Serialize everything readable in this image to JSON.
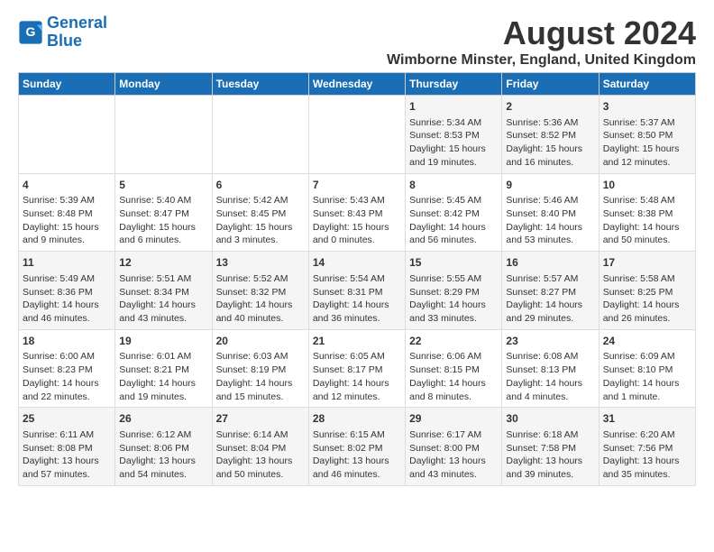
{
  "header": {
    "logo_general": "General",
    "logo_blue": "Blue",
    "title": "August 2024",
    "subtitle": "Wimborne Minster, England, United Kingdom"
  },
  "days_of_week": [
    "Sunday",
    "Monday",
    "Tuesday",
    "Wednesday",
    "Thursday",
    "Friday",
    "Saturday"
  ],
  "weeks": [
    {
      "days": [
        {
          "num": "",
          "content": ""
        },
        {
          "num": "",
          "content": ""
        },
        {
          "num": "",
          "content": ""
        },
        {
          "num": "",
          "content": ""
        },
        {
          "num": "1",
          "content": "Sunrise: 5:34 AM\nSunset: 8:53 PM\nDaylight: 15 hours\nand 19 minutes."
        },
        {
          "num": "2",
          "content": "Sunrise: 5:36 AM\nSunset: 8:52 PM\nDaylight: 15 hours\nand 16 minutes."
        },
        {
          "num": "3",
          "content": "Sunrise: 5:37 AM\nSunset: 8:50 PM\nDaylight: 15 hours\nand 12 minutes."
        }
      ]
    },
    {
      "days": [
        {
          "num": "4",
          "content": "Sunrise: 5:39 AM\nSunset: 8:48 PM\nDaylight: 15 hours\nand 9 minutes."
        },
        {
          "num": "5",
          "content": "Sunrise: 5:40 AM\nSunset: 8:47 PM\nDaylight: 15 hours\nand 6 minutes."
        },
        {
          "num": "6",
          "content": "Sunrise: 5:42 AM\nSunset: 8:45 PM\nDaylight: 15 hours\nand 3 minutes."
        },
        {
          "num": "7",
          "content": "Sunrise: 5:43 AM\nSunset: 8:43 PM\nDaylight: 15 hours\nand 0 minutes."
        },
        {
          "num": "8",
          "content": "Sunrise: 5:45 AM\nSunset: 8:42 PM\nDaylight: 14 hours\nand 56 minutes."
        },
        {
          "num": "9",
          "content": "Sunrise: 5:46 AM\nSunset: 8:40 PM\nDaylight: 14 hours\nand 53 minutes."
        },
        {
          "num": "10",
          "content": "Sunrise: 5:48 AM\nSunset: 8:38 PM\nDaylight: 14 hours\nand 50 minutes."
        }
      ]
    },
    {
      "days": [
        {
          "num": "11",
          "content": "Sunrise: 5:49 AM\nSunset: 8:36 PM\nDaylight: 14 hours\nand 46 minutes."
        },
        {
          "num": "12",
          "content": "Sunrise: 5:51 AM\nSunset: 8:34 PM\nDaylight: 14 hours\nand 43 minutes."
        },
        {
          "num": "13",
          "content": "Sunrise: 5:52 AM\nSunset: 8:32 PM\nDaylight: 14 hours\nand 40 minutes."
        },
        {
          "num": "14",
          "content": "Sunrise: 5:54 AM\nSunset: 8:31 PM\nDaylight: 14 hours\nand 36 minutes."
        },
        {
          "num": "15",
          "content": "Sunrise: 5:55 AM\nSunset: 8:29 PM\nDaylight: 14 hours\nand 33 minutes."
        },
        {
          "num": "16",
          "content": "Sunrise: 5:57 AM\nSunset: 8:27 PM\nDaylight: 14 hours\nand 29 minutes."
        },
        {
          "num": "17",
          "content": "Sunrise: 5:58 AM\nSunset: 8:25 PM\nDaylight: 14 hours\nand 26 minutes."
        }
      ]
    },
    {
      "days": [
        {
          "num": "18",
          "content": "Sunrise: 6:00 AM\nSunset: 8:23 PM\nDaylight: 14 hours\nand 22 minutes."
        },
        {
          "num": "19",
          "content": "Sunrise: 6:01 AM\nSunset: 8:21 PM\nDaylight: 14 hours\nand 19 minutes."
        },
        {
          "num": "20",
          "content": "Sunrise: 6:03 AM\nSunset: 8:19 PM\nDaylight: 14 hours\nand 15 minutes."
        },
        {
          "num": "21",
          "content": "Sunrise: 6:05 AM\nSunset: 8:17 PM\nDaylight: 14 hours\nand 12 minutes."
        },
        {
          "num": "22",
          "content": "Sunrise: 6:06 AM\nSunset: 8:15 PM\nDaylight: 14 hours\nand 8 minutes."
        },
        {
          "num": "23",
          "content": "Sunrise: 6:08 AM\nSunset: 8:13 PM\nDaylight: 14 hours\nand 4 minutes."
        },
        {
          "num": "24",
          "content": "Sunrise: 6:09 AM\nSunset: 8:10 PM\nDaylight: 14 hours\nand 1 minute."
        }
      ]
    },
    {
      "days": [
        {
          "num": "25",
          "content": "Sunrise: 6:11 AM\nSunset: 8:08 PM\nDaylight: 13 hours\nand 57 minutes."
        },
        {
          "num": "26",
          "content": "Sunrise: 6:12 AM\nSunset: 8:06 PM\nDaylight: 13 hours\nand 54 minutes."
        },
        {
          "num": "27",
          "content": "Sunrise: 6:14 AM\nSunset: 8:04 PM\nDaylight: 13 hours\nand 50 minutes."
        },
        {
          "num": "28",
          "content": "Sunrise: 6:15 AM\nSunset: 8:02 PM\nDaylight: 13 hours\nand 46 minutes."
        },
        {
          "num": "29",
          "content": "Sunrise: 6:17 AM\nSunset: 8:00 PM\nDaylight: 13 hours\nand 43 minutes."
        },
        {
          "num": "30",
          "content": "Sunrise: 6:18 AM\nSunset: 7:58 PM\nDaylight: 13 hours\nand 39 minutes."
        },
        {
          "num": "31",
          "content": "Sunrise: 6:20 AM\nSunset: 7:56 PM\nDaylight: 13 hours\nand 35 minutes."
        }
      ]
    }
  ]
}
